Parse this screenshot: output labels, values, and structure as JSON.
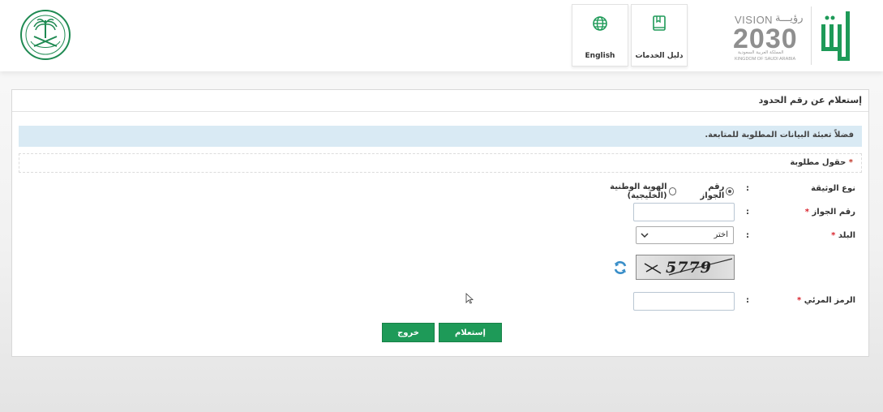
{
  "header": {
    "nav": {
      "english_label": "English",
      "guide_label": "دليل الخدمات"
    },
    "vision": {
      "title": "VISION",
      "arabic": "رؤيـــة",
      "year": "2030",
      "subtitle_ar": "المملكة العربية السعودية",
      "subtitle_en": "KINGDOM OF SAUDI ARABIA"
    }
  },
  "panel": {
    "title": "إستعلام عن رقم الحدود",
    "info_message": "فضلاً تعبئة البيانات المطلوبة للمتابعة.",
    "required_note": "حقول مطلوبة",
    "required_star": "*",
    "form": {
      "doc_type_label": "نوع الوثيقة",
      "doc_type_options": [
        "رقم الجواز",
        "الهوية الوطنية (الخليجية)"
      ],
      "doc_type_selected": 0,
      "passport_label": "رقم الجواز",
      "country_label": "البلد",
      "country_selected": "اختر",
      "captcha_label": "الرمز المرئي",
      "captcha_text": "5779",
      "colon": ":",
      "star": "*"
    },
    "buttons": {
      "inquire_label": "إستعلام",
      "exit_label": "خروج"
    }
  },
  "colors": {
    "accent": "#1e9a58",
    "info_bar": "#d9eaf4",
    "required_star": "#d9232d"
  }
}
